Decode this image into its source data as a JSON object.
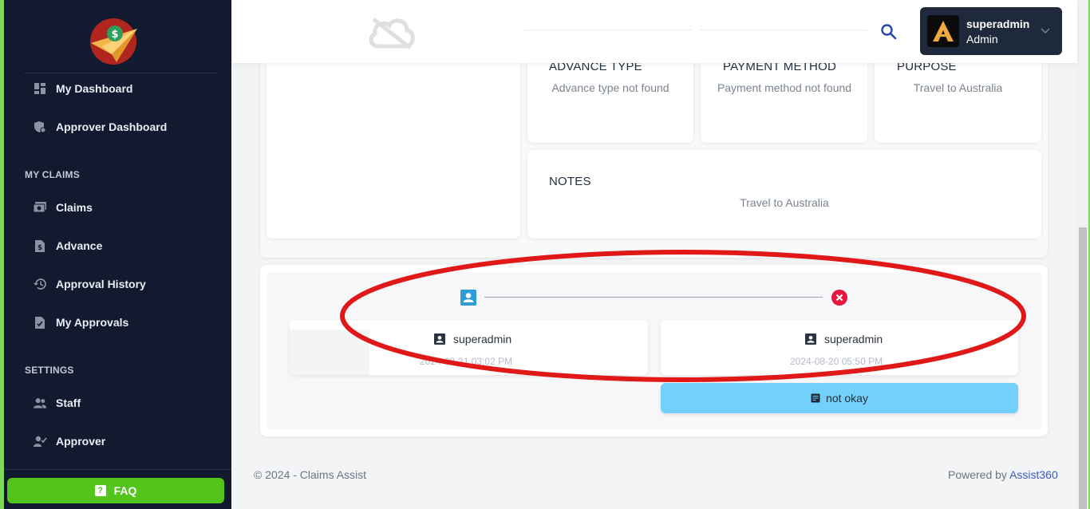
{
  "sidebar": {
    "nav_main": [
      {
        "label": "My Dashboard",
        "icon": "dashboard-icon"
      },
      {
        "label": "Approver Dashboard",
        "icon": "shield-dashboard-icon"
      }
    ],
    "section_claims": "MY CLAIMS",
    "nav_claims": [
      {
        "label": "Claims",
        "icon": "money-icon"
      },
      {
        "label": "Advance",
        "icon": "dollar-file-icon"
      },
      {
        "label": "Approval History",
        "icon": "history-icon"
      },
      {
        "label": "My Approvals",
        "icon": "approved-file-icon"
      }
    ],
    "section_settings": "SETTINGS",
    "nav_settings": [
      {
        "label": "Staff",
        "icon": "users-icon"
      },
      {
        "label": "Approver",
        "icon": "user-check-icon"
      }
    ],
    "faq_label": "FAQ"
  },
  "header": {
    "user_name": "superadmin",
    "user_role": "Admin"
  },
  "details": {
    "advance_type_title": "ADVANCE TYPE",
    "advance_type_value": "Advance type not found",
    "payment_method_title": "PAYMENT METHOD",
    "payment_method_value": "Payment method not found",
    "purpose_title": "PURPOSE",
    "purpose_value": "Travel to Australia",
    "notes_title": "NOTES",
    "notes_value": "Travel to Australia"
  },
  "approval_flow": {
    "steps": [
      {
        "name": "superadmin",
        "date": "2024-08-21 03:02 PM",
        "status": "submitted"
      },
      {
        "name": "superadmin",
        "date": "2024-08-20 05:50 PM",
        "status": "rejected"
      }
    ],
    "comment": "not okay"
  },
  "footer": {
    "copyright": "© 2024 - Claims Assist",
    "powered_prefix": "Powered by ",
    "powered_link": "Assist360"
  },
  "colors": {
    "sidebar_bg": "#111a2e",
    "faq_green": "#52c41a",
    "accent_blue": "#2d9cdb",
    "reject_red": "#e8173f",
    "comment_bg": "#73d0fb",
    "annotation_red": "#e01818"
  }
}
